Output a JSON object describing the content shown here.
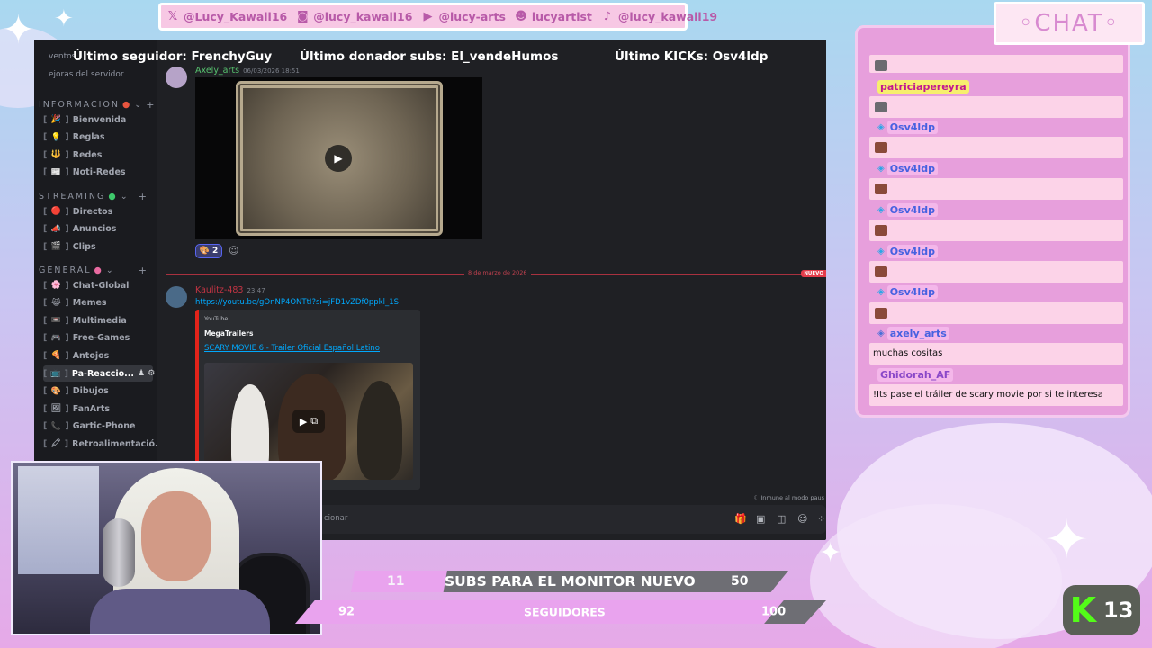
{
  "social": [
    {
      "icon": "x-icon",
      "glyph": "𝕏",
      "handle": "@Lucy_Kawaii16"
    },
    {
      "icon": "instagram-icon",
      "glyph": "◙",
      "handle": "@lucy_kawaii16"
    },
    {
      "icon": "youtube-icon",
      "glyph": "▶",
      "handle": "@lucy-arts"
    },
    {
      "icon": "discord-icon",
      "glyph": "☻",
      "handle": "lucyartist"
    },
    {
      "icon": "tiktok-icon",
      "glyph": "♪",
      "handle": "@lucy_kawaii19"
    }
  ],
  "overlay": {
    "last_follower": "Último seguidor: FrenchyGuy",
    "last_donor": "Último donador subs: El_vendeHumos",
    "last_kicks": "Último KICKs: Osv4ldp"
  },
  "discord": {
    "sidebar_top": [
      "ventos",
      "ejoras del servidor"
    ],
    "categories": [
      {
        "name": "INFORMACION",
        "channels": [
          {
            "label": "Bienvenida",
            "emoji": "🎉"
          },
          {
            "label": "Reglas",
            "emoji": "💡"
          },
          {
            "label": "Redes",
            "emoji": "🔱"
          },
          {
            "label": "Noti-Redes",
            "emoji": "📰"
          }
        ]
      },
      {
        "name": "STREAMING",
        "channels": [
          {
            "label": "Directos",
            "emoji": "🔴"
          },
          {
            "label": "Anuncios",
            "emoji": "📣"
          },
          {
            "label": "Clips",
            "emoji": "🎬"
          }
        ]
      },
      {
        "name": "GENERAL",
        "channels": [
          {
            "label": "Chat-Global",
            "emoji": "🌸"
          },
          {
            "label": "Memes",
            "emoji": "😹"
          },
          {
            "label": "Multimedia",
            "emoji": "📼"
          },
          {
            "label": "Free-Games",
            "emoji": "🎮"
          },
          {
            "label": "Antojos",
            "emoji": "🍕"
          },
          {
            "label": "Pa-Reaccio...",
            "emoji": "📺"
          },
          {
            "label": "Dibujos",
            "emoji": "🎨"
          },
          {
            "label": "FanArts",
            "emoji": "🖼"
          },
          {
            "label": "Gartic-Phone",
            "emoji": "📞"
          },
          {
            "label": "Retroalimentació...",
            "emoji": "🖍"
          }
        ]
      }
    ],
    "messages": {
      "first": {
        "author": "Axely_arts",
        "time": "06/03/2026 18:51",
        "reaction_emoji": "🎨",
        "reaction_count": "2"
      },
      "date_divider": "8 de marzo de 2026",
      "new_badge": "NUEVO",
      "second": {
        "author": "Kaulitz-483",
        "time": "23:47",
        "link": "https://youtu.be/gOnNP4ONTtI?si=jFD1vZDf0ppkl_1S",
        "embed": {
          "provider": "YouTube",
          "author": "MegaTrailers",
          "title": "SCARY MOVIE 6 - Trailer Oficial Español Latino"
        }
      }
    },
    "immune_notice": "Inmune al modo paus",
    "composer_placeholder": "cionar"
  },
  "goals": {
    "subs": {
      "current": "11",
      "label": "SUBS PARA EL MONITOR NUEVO",
      "target": "50",
      "progress": 0.22
    },
    "followers": {
      "current": "92",
      "label": "SEGUIDORES",
      "target": "100",
      "progress": 0.92
    }
  },
  "chat": {
    "title": "◦CHAT◦",
    "messages": [
      {
        "user": "",
        "text": "",
        "emote": true,
        "badge": false
      },
      {
        "user": "patriciapereyra",
        "text": "",
        "emote": true,
        "badge": false
      },
      {
        "user": "Osv4ldp",
        "text": "",
        "emote": true,
        "badge": true
      },
      {
        "user": "Osv4ldp",
        "text": "",
        "emote": true,
        "badge": true
      },
      {
        "user": "Osv4ldp",
        "text": "",
        "emote": true,
        "badge": true
      },
      {
        "user": "Osv4ldp",
        "text": "",
        "emote": true,
        "badge": true
      },
      {
        "user": "Osv4ldp",
        "text": "",
        "emote": true,
        "badge": true
      },
      {
        "user": "axely_arts",
        "text": "muchas cositas",
        "emote": false,
        "badge": true
      },
      {
        "user": "Ghidorah_AF",
        "text": "!Its pase el tráiler de scary movie por si te interesa",
        "emote": false,
        "badge": false
      }
    ]
  },
  "kick": {
    "count": "13",
    "letter": "K"
  },
  "colors": {
    "accent_pink": "#e9a3ee",
    "discord_bg": "#1f2024",
    "link_blue": "#00a8fc",
    "kick_green": "#53fc18",
    "divider_red": "#a8313f"
  }
}
